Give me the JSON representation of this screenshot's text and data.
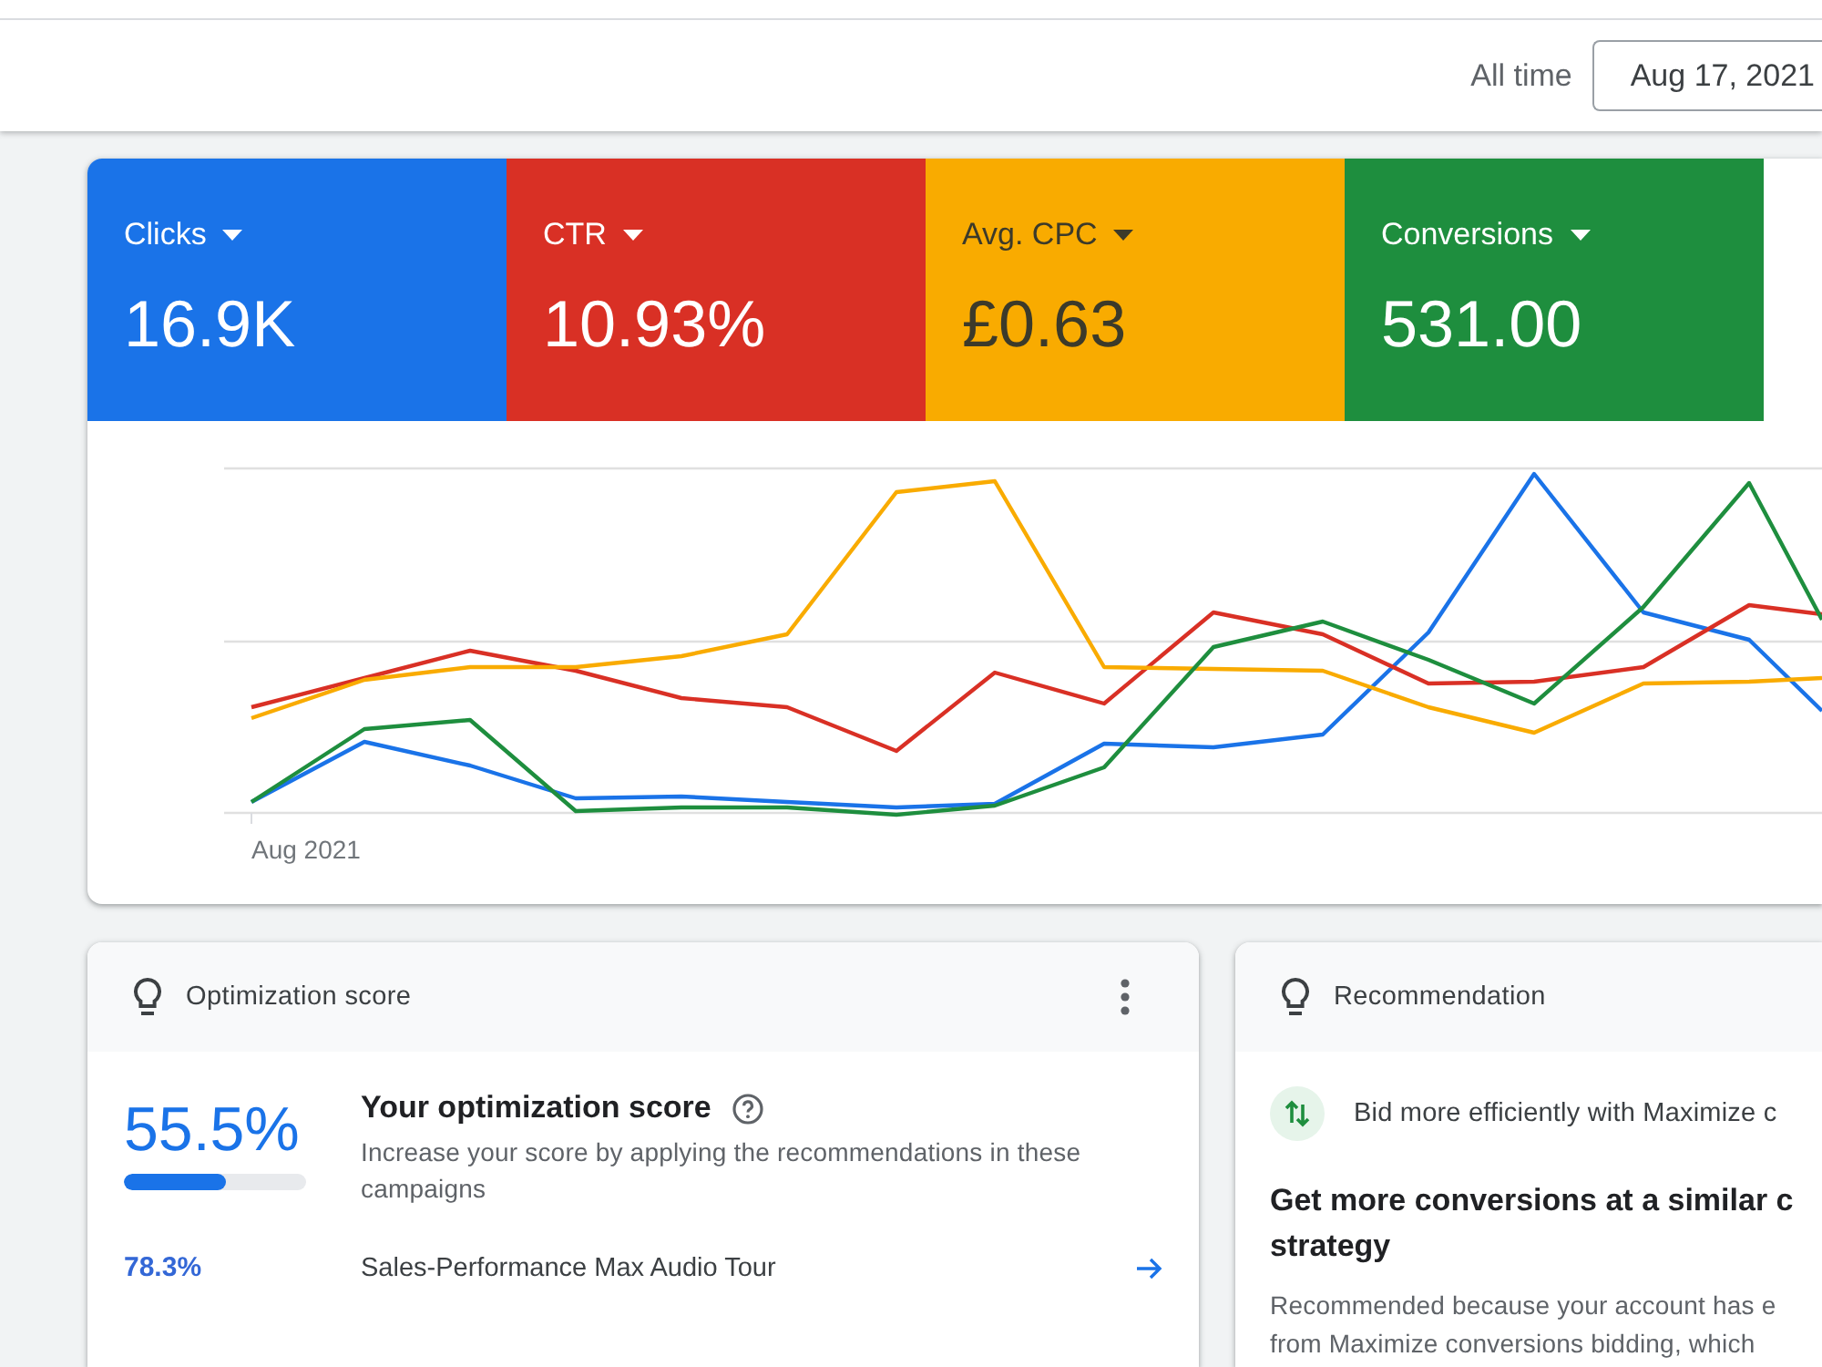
{
  "toolbar": {
    "range_label": "All time",
    "date_field": {
      "value": "Aug 17, 2021"
    }
  },
  "metrics": [
    {
      "label": "Clicks",
      "value": "16.9K",
      "color": "#1a73e8"
    },
    {
      "label": "CTR",
      "value": "10.93%",
      "color": "#d93025"
    },
    {
      "label": "Avg. CPC",
      "value": "£0.63",
      "color": "#f9ab00"
    },
    {
      "label": "Conversions",
      "value": "531.00",
      "color": "#1e8e3e"
    }
  ],
  "chart": {
    "x_label": "Aug 2021"
  },
  "optimization_card": {
    "title": "Optimization score",
    "score": "55.5%",
    "level": 0.555,
    "heading": "Your optimization score",
    "description": "Increase your score by applying the recommendations in these campaigns",
    "campaigns": [
      {
        "score": "78.3%",
        "name": "Sales-Performance Max Audio Tour"
      }
    ]
  },
  "recommendation_card": {
    "title": "Recommendation",
    "summary": "Bid more efficiently with Maximize c",
    "heading_lines": [
      "Get more conversions at a similar c",
      "strategy"
    ],
    "description_lines": [
      "Recommended because your account has e",
      "from Maximize conversions bidding, which"
    ]
  }
}
